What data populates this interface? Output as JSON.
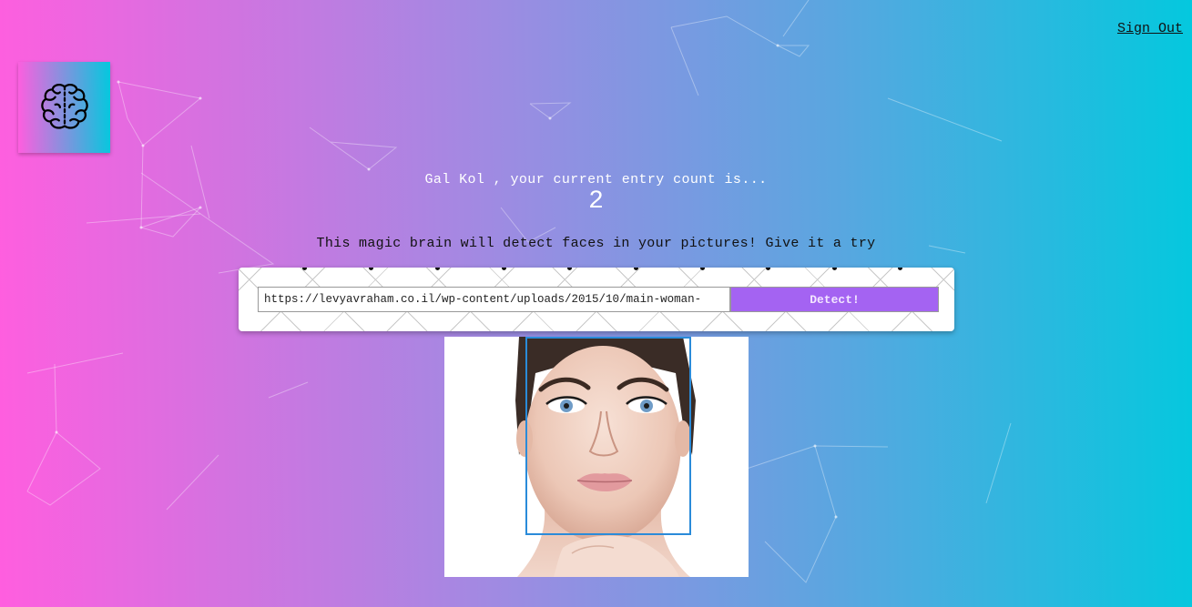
{
  "nav": {
    "signout_label": "Sign Out"
  },
  "logo": {
    "icon": "brain-icon"
  },
  "rank": {
    "message": "Gal Kol , your current entry count is...",
    "count": "2"
  },
  "intro": {
    "text": "This magic brain will detect faces in your pictures! Give it a try"
  },
  "form": {
    "url_value": "https://levyavraham.co.il/wp-content/uploads/2015/10/main-woman-",
    "detect_label": "Detect!"
  },
  "colors": {
    "gradient_start": "#ff5edf",
    "gradient_end": "#04c8de",
    "button": "#a463f2",
    "face_box": "#2a8bd9"
  }
}
